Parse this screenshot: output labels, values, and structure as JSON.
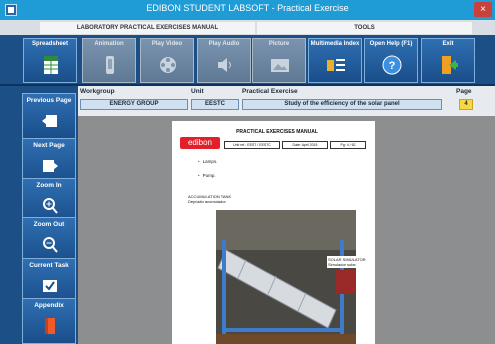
{
  "window": {
    "title": "EDIBON STUDENT LABSOFT - Practical Exercise",
    "close": "×"
  },
  "tabs": [
    {
      "label": "LABORATORY PRACTICAL EXERCISES MANUAL"
    },
    {
      "label": "TOOLS"
    }
  ],
  "toolbar": [
    {
      "label": "Spreadsheet",
      "icon": "spreadsheet-icon",
      "enabled": true
    },
    {
      "label": "Animation",
      "icon": "animation-icon",
      "enabled": false
    },
    {
      "label": "Play Video",
      "icon": "film-reel-icon",
      "enabled": false
    },
    {
      "label": "Play Audio",
      "icon": "speaker-icon",
      "enabled": false
    },
    {
      "label": "Picture",
      "icon": "picture-icon",
      "enabled": false
    },
    {
      "label": "Multimedia Index",
      "icon": "multimedia-index-icon",
      "enabled": true
    },
    {
      "label": "Open Help (F1)",
      "icon": "help-icon",
      "enabled": true
    },
    {
      "label": "Exit",
      "icon": "exit-door-icon",
      "enabled": true
    }
  ],
  "nav": [
    {
      "label": "Previous Page",
      "icon": "previous-page-icon"
    },
    {
      "label": "Next Page",
      "icon": "next-page-icon"
    },
    {
      "label": "Zoom In",
      "icon": "zoom-in-icon"
    },
    {
      "label": "Zoom Out",
      "icon": "zoom-out-icon"
    },
    {
      "label": "Current Task",
      "icon": "current-task-icon"
    },
    {
      "label": "Appendix",
      "icon": "appendix-icon"
    }
  ],
  "header": {
    "workgroup_label": "Workgroup",
    "workgroup_value": "ENERGY GROUP",
    "unit_label": "Unit",
    "unit_value": "EESTC",
    "exercise_label": "Practical Exercise",
    "exercise_value": "Study of the efficiency of the solar panel",
    "page_label": "Page",
    "page_value": "4"
  },
  "document": {
    "title": "PRACTICAL EXERCISES MANUAL",
    "logo": "edibon",
    "unit_cell": "Unit ref.: EEST / EESTC",
    "date_cell": "Date: April 2015",
    "page_cell": "Pg: 4 / 62",
    "bullets": [
      "Lamps.",
      "Pump."
    ],
    "accumulation_label": "ACCUMULATION TANK",
    "accumulation_sub": "Depósito acumulador",
    "simulator_label": "SOLAR SIMULATOR",
    "simulator_sub": "Simulador solar"
  },
  "colors": {
    "accent": "#1f9bd6",
    "toolbar": "#1b4f86",
    "page_badge": "#f7d842",
    "logo": "#e1202a"
  }
}
